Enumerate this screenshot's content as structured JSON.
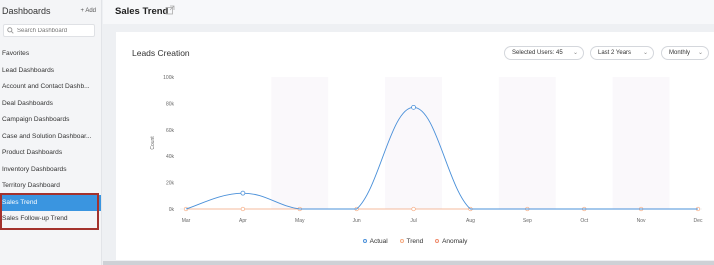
{
  "sidebar": {
    "title": "Dashboards",
    "add_label": "+ Add",
    "search_placeholder": "Search Dashboard",
    "items": [
      {
        "label": "Favorites"
      },
      {
        "label": "Lead Dashboards"
      },
      {
        "label": "Account and Contact Dashb..."
      },
      {
        "label": "Deal Dashboards"
      },
      {
        "label": "Campaign Dashboards"
      },
      {
        "label": "Case and Solution Dashboar..."
      },
      {
        "label": "Product Dashboards"
      },
      {
        "label": "Inventory Dashboards"
      },
      {
        "label": "Territory Dashboard"
      },
      {
        "label": "Sales Trend"
      },
      {
        "label": "Sales Follow-up Trend"
      }
    ],
    "active_label": "Sales Trend"
  },
  "header": {
    "title": "Sales Trend"
  },
  "card": {
    "title": "Leads Creation",
    "filters": {
      "users": "Selected Users: 45",
      "period": "Last 2 Years",
      "interval": "Monthly"
    }
  },
  "colors": {
    "actual": "#4a90d9",
    "trend": "#f5a97f",
    "anomaly": "#ef8a6a",
    "active": "#3a95e0",
    "highlight": "#a3322d"
  },
  "chart_data": {
    "type": "line",
    "ylabel": "Count",
    "categories": [
      "Mar",
      "Apr",
      "May",
      "Jun",
      "Jul",
      "Aug",
      "Sep",
      "Oct",
      "Nov",
      "Dec"
    ],
    "y_ticks": [
      "0k",
      "20k",
      "40k",
      "60k",
      "80k",
      "100k"
    ],
    "ylim": [
      0,
      100000
    ],
    "series": [
      {
        "name": "Actual",
        "values": [
          0,
          12000,
          0,
          0,
          77000,
          0,
          0,
          0,
          0,
          0
        ]
      },
      {
        "name": "Trend",
        "values": [
          0,
          0,
          0,
          0,
          0,
          0,
          0,
          0,
          0,
          0
        ]
      },
      {
        "name": "Anomaly",
        "values": []
      }
    ],
    "legend_position": "bottom",
    "grid": false
  }
}
